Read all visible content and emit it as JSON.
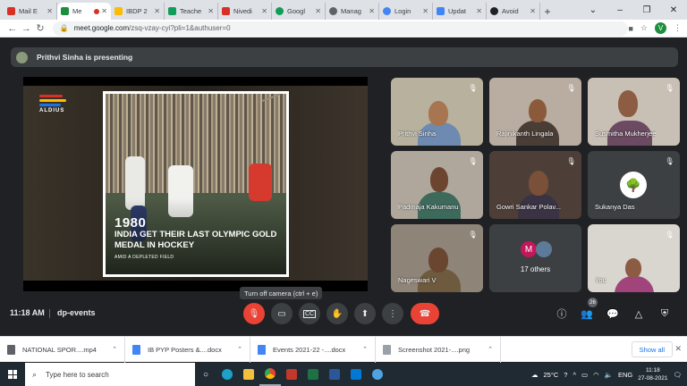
{
  "browser": {
    "tabs": [
      {
        "title": "Mail E",
        "color": "#d93025"
      },
      {
        "title": "Me",
        "color": "#1e8e3e",
        "active": true
      },
      {
        "title": "IBDP 2",
        "color": "#fbbc04"
      },
      {
        "title": "Teache",
        "color": "#0f9d58"
      },
      {
        "title": "Nivedi",
        "color": "#d93025"
      },
      {
        "title": "Googl",
        "color": "#0f9d58"
      },
      {
        "title": "Manag",
        "color": "#5f6368"
      },
      {
        "title": "Login",
        "color": "#4285f4"
      },
      {
        "title": "Updat",
        "color": "#4285f4"
      },
      {
        "title": "Avoid",
        "color": "#202124"
      }
    ],
    "url_domain": "meet.google.com",
    "url_path": "/zsq-vzay-cyi?pli=1&authuser=0",
    "profile_initial": "V"
  },
  "meet": {
    "presenting_text": "Prithvi Sinha is presenting",
    "slide": {
      "logo_text": "ALDIUS",
      "year": "1980",
      "headline": "INDIA GET THEIR LAST OLYMPIC GOLD MEDAL IN HOCKEY",
      "subhead": "AMID A DEPLETED FIELD"
    },
    "tooltip": "Turn off camera (ctrl + e)",
    "participants": [
      {
        "name": "Prithvi Sinha"
      },
      {
        "name": "Rajinikanth Lingala"
      },
      {
        "name": "Susmitha Mukherjee"
      },
      {
        "name": "Padmaja Kakumanu"
      },
      {
        "name": "Gowri Sankar Polav..."
      },
      {
        "name": "Sukanya Das"
      },
      {
        "name": "Nageswari V"
      },
      {
        "name": "17 others",
        "avatar_initial": "M"
      },
      {
        "name": "You"
      }
    ],
    "time": "11:18 AM",
    "meeting_code": "dp-events",
    "people_count": "26"
  },
  "downloads": {
    "items": [
      {
        "name": "NATIONAL SPOR....mp4",
        "color": "#5f6368"
      },
      {
        "name": "IB PYP Posters &....docx",
        "color": "#4285f4"
      },
      {
        "name": "Events 2021-22 -....docx",
        "color": "#4285f4"
      },
      {
        "name": "Screenshot 2021-....png",
        "color": "#5f6368"
      }
    ],
    "show_all": "Show all"
  },
  "taskbar": {
    "search_placeholder": "Type here to search",
    "temperature": "25°C",
    "language": "ENG",
    "time": "11:18",
    "date": "27-08-2021"
  }
}
